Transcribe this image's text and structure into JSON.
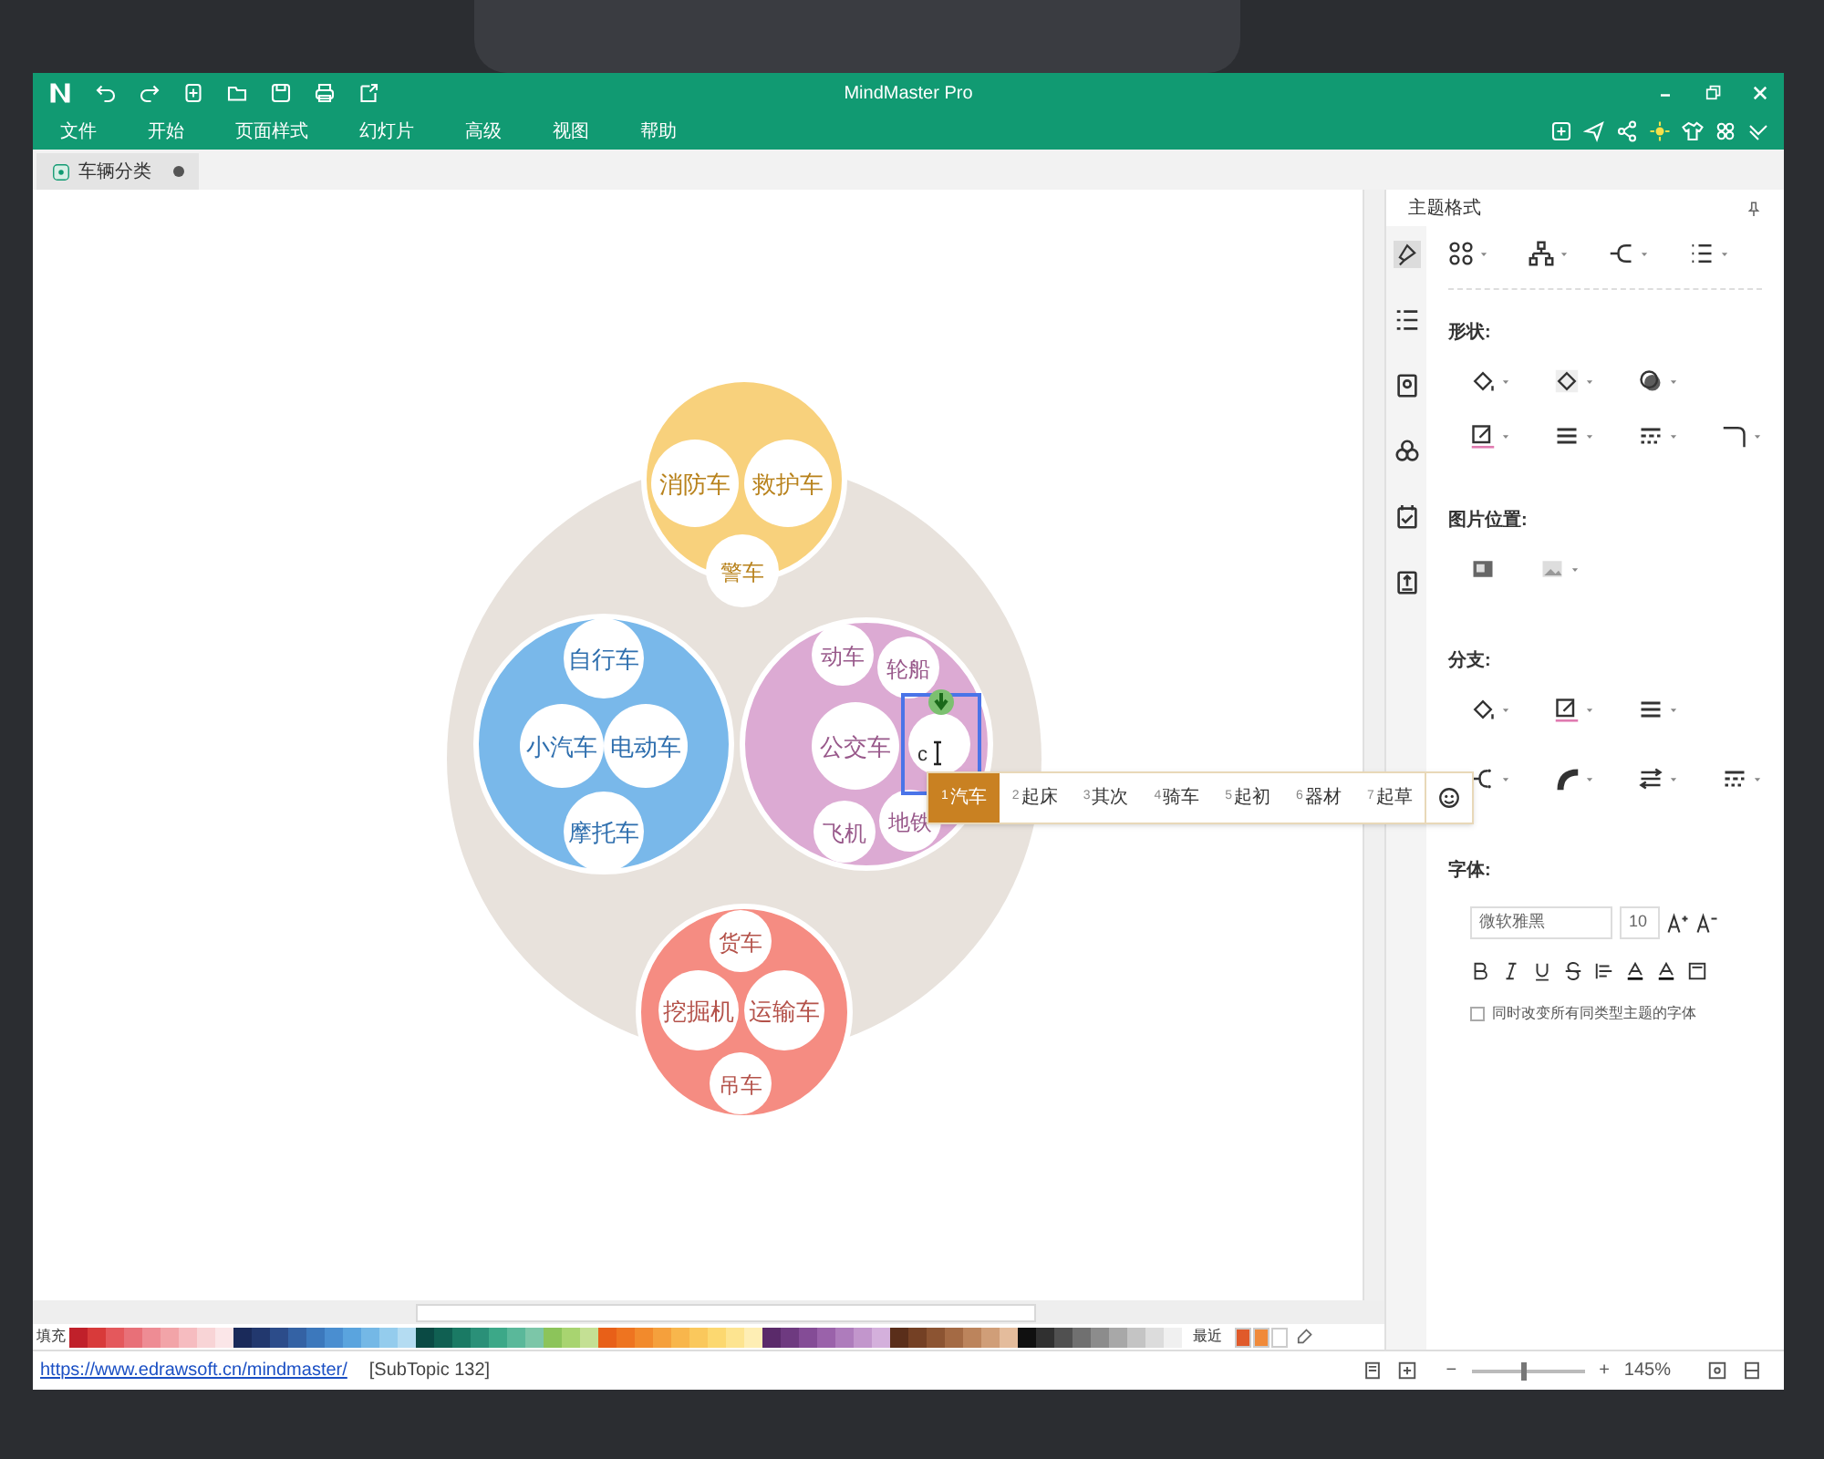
{
  "window": {
    "title": "MindMaster Pro"
  },
  "menu": [
    "文件",
    "开始",
    "页面样式",
    "幻灯片",
    "高级",
    "视图",
    "帮助"
  ],
  "document_tab": {
    "label": "车辆分类",
    "modified": true
  },
  "mind_map": {
    "groups": [
      {
        "color": "#f8d17c",
        "topics": [
          "消防车",
          "救护车",
          "警车"
        ]
      },
      {
        "color": "#79b8ea",
        "topics": [
          "自行车",
          "小汽车",
          "电动车",
          "摩托车"
        ]
      },
      {
        "color": "#dcaad3",
        "topics": [
          "动车",
          "轮船",
          "公交车",
          "飞机",
          "地铁"
        ]
      },
      {
        "color": "#f58c82",
        "topics": [
          "货车",
          "挖掘机",
          "运输车",
          "吊车"
        ]
      }
    ],
    "editing": {
      "typed": "c"
    }
  },
  "ime_candidates": [
    {
      "number": "1",
      "text": "汽车",
      "selected": true
    },
    {
      "number": "2",
      "text": "起床",
      "selected": false
    },
    {
      "number": "3",
      "text": "其次",
      "selected": false
    },
    {
      "number": "4",
      "text": "骑车",
      "selected": false
    },
    {
      "number": "5",
      "text": "起初",
      "selected": false
    },
    {
      "number": "6",
      "text": "器材",
      "selected": false
    },
    {
      "number": "7",
      "text": "起草",
      "selected": false
    }
  ],
  "panel": {
    "title": "主题格式",
    "sections": [
      "形状:",
      "图片位置:",
      "分支:",
      "字体:"
    ],
    "font_family": "微软雅黑",
    "font_size": "10",
    "apply_all": {
      "label": "同时改变所有同类型主题的字体",
      "checked": false
    }
  },
  "palette": {
    "label": "填充",
    "recent_label": "最近",
    "swatches": [
      {
        "color": "#c0202a"
      },
      {
        "color": "#d83a3a"
      },
      {
        "color": "#e4585c"
      },
      {
        "color": "#e87078"
      },
      {
        "color": "#ee8c94"
      },
      {
        "color": "#f2a4a8"
      },
      {
        "color": "#f6bcc0"
      },
      {
        "color": "#f8d4d6"
      },
      {
        "color": "#fbe6e8"
      },
      {
        "color": "#1a2a5a"
      },
      {
        "color": "#22386e"
      },
      {
        "color": "#2c4c8a"
      },
      {
        "color": "#3462a4"
      },
      {
        "color": "#3c78bc"
      },
      {
        "color": "#4a8ed0"
      },
      {
        "color": "#5aa4de"
      },
      {
        "color": "#74b8e6"
      },
      {
        "color": "#94cced"
      },
      {
        "color": "#b4dcf2"
      },
      {
        "color": "#0a4a44"
      },
      {
        "color": "#106052"
      },
      {
        "color": "#1a7a64"
      },
      {
        "color": "#2a9078"
      },
      {
        "color": "#3ca888"
      },
      {
        "color": "#5ab89a"
      },
      {
        "color": "#7cc6a8"
      },
      {
        "color": "#8cc45a"
      },
      {
        "color": "#a8d470"
      },
      {
        "color": "#c4e094"
      },
      {
        "color": "#e86018"
      },
      {
        "color": "#ee7420"
      },
      {
        "color": "#f28a2c"
      },
      {
        "color": "#f5a03c"
      },
      {
        "color": "#f8b64c"
      },
      {
        "color": "#fac85c"
      },
      {
        "color": "#fcd870"
      },
      {
        "color": "#fde490"
      },
      {
        "color": "#feeeb4"
      },
      {
        "color": "#5a2a6a"
      },
      {
        "color": "#6e3a80"
      },
      {
        "color": "#844c96"
      },
      {
        "color": "#9a62aa"
      },
      {
        "color": "#ae7cbc"
      },
      {
        "color": "#c296cc"
      },
      {
        "color": "#d4b0dc"
      },
      {
        "color": "#5a2e1a"
      },
      {
        "color": "#744024"
      },
      {
        "color": "#8c5432"
      },
      {
        "color": "#a46a44"
      },
      {
        "color": "#bc845c"
      },
      {
        "color": "#d09e78"
      },
      {
        "color": "#e4bc9c"
      },
      {
        "color": "#101010"
      },
      {
        "color": "#303030"
      },
      {
        "color": "#505050"
      },
      {
        "color": "#707070"
      },
      {
        "color": "#8c8c8c"
      },
      {
        "color": "#a8a8a8"
      },
      {
        "color": "#c4c4c4"
      },
      {
        "color": "#dcdcdc"
      },
      {
        "color": "#f0f0f0"
      }
    ],
    "recent": [
      {
        "color": "#e05a2a"
      },
      {
        "color": "#f08a3a"
      },
      {
        "color": "#ffffff"
      }
    ]
  },
  "status_bar": {
    "link": "https://www.edrawsoft.cn/mindmaster/",
    "info": "[SubTopic 132]",
    "zoom_out": "−",
    "zoom_in": "+",
    "zoom": "145%",
    "level": 0.45
  }
}
